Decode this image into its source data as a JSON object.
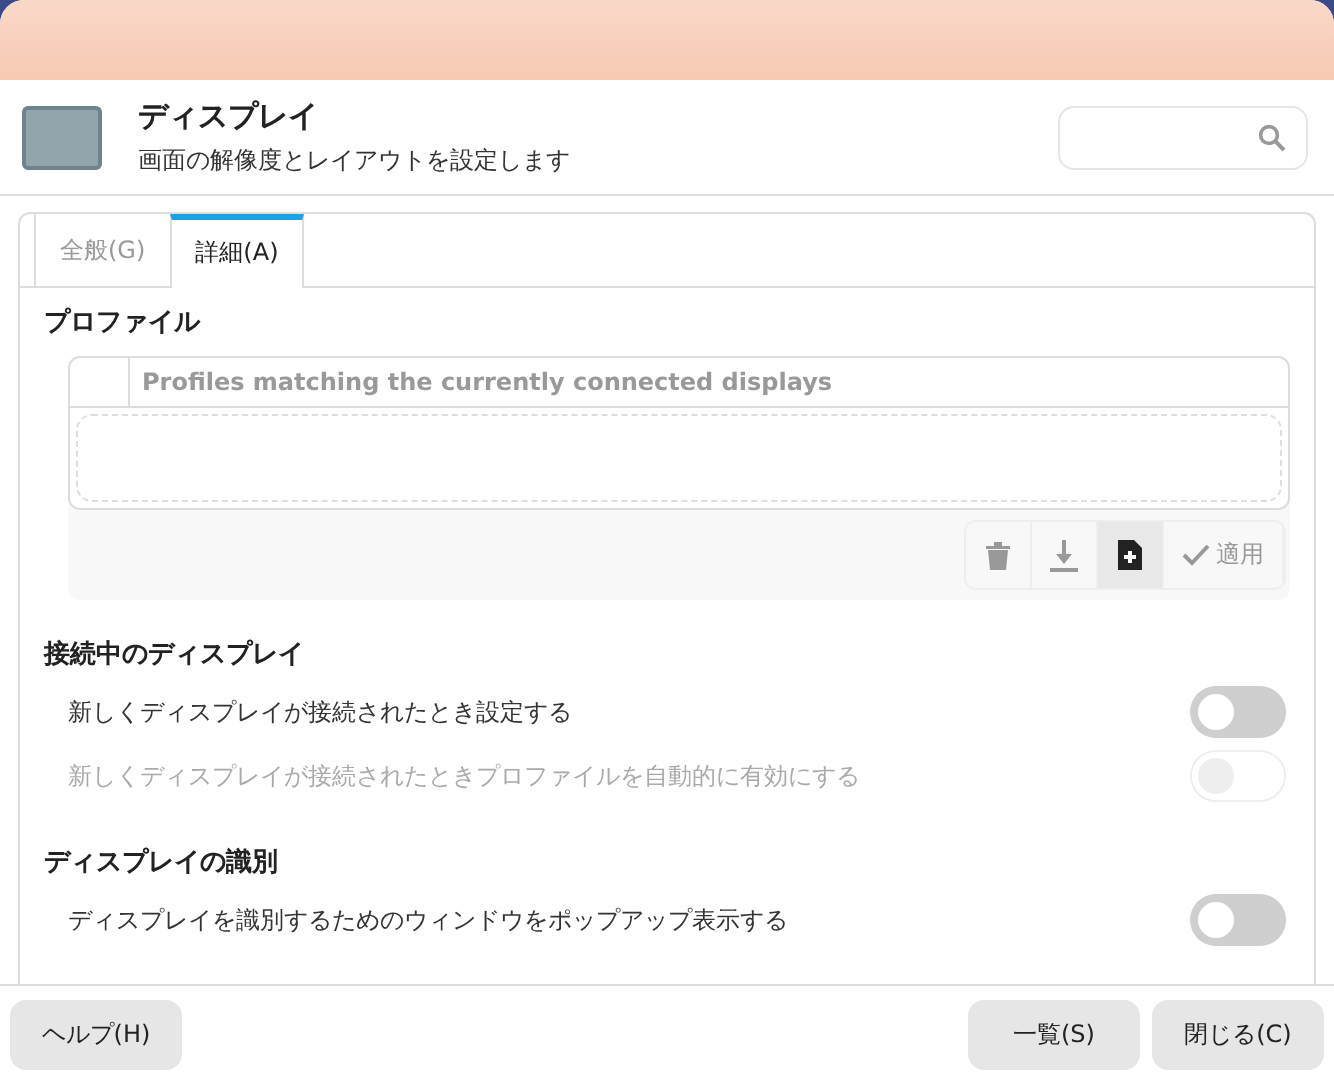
{
  "header": {
    "title": "ディスプレイ",
    "subtitle": "画面の解像度とレイアウトを設定します"
  },
  "tabs": [
    {
      "label": "全般(G)",
      "selected": false
    },
    {
      "label": "詳細(A)",
      "selected": true
    }
  ],
  "profiles": {
    "heading": "プロファイル",
    "column_header": "Profiles matching the currently connected displays",
    "toolbar": [
      {
        "kind": "delete",
        "disabled": true
      },
      {
        "kind": "download",
        "disabled": true
      },
      {
        "kind": "new",
        "disabled": false
      },
      {
        "kind": "apply",
        "label": "適用",
        "disabled": true
      }
    ]
  },
  "sections": [
    {
      "heading": "接続中のディスプレイ",
      "options": [
        {
          "label": "新しくディスプレイが接続されたとき設定する",
          "on": false,
          "disabled": false
        },
        {
          "label": "新しくディスプレイが接続されたときプロファイルを自動的に有効にする",
          "on": false,
          "disabled": true
        }
      ]
    },
    {
      "heading": "ディスプレイの識別",
      "options": [
        {
          "label": "ディスプレイを識別するためのウィンドウをポップアップ表示する",
          "on": false,
          "disabled": false
        }
      ]
    }
  ],
  "buttons": {
    "left": [
      "ヘルプ(H)"
    ],
    "right": [
      "一覧(S)",
      "閉じる(C)"
    ]
  }
}
